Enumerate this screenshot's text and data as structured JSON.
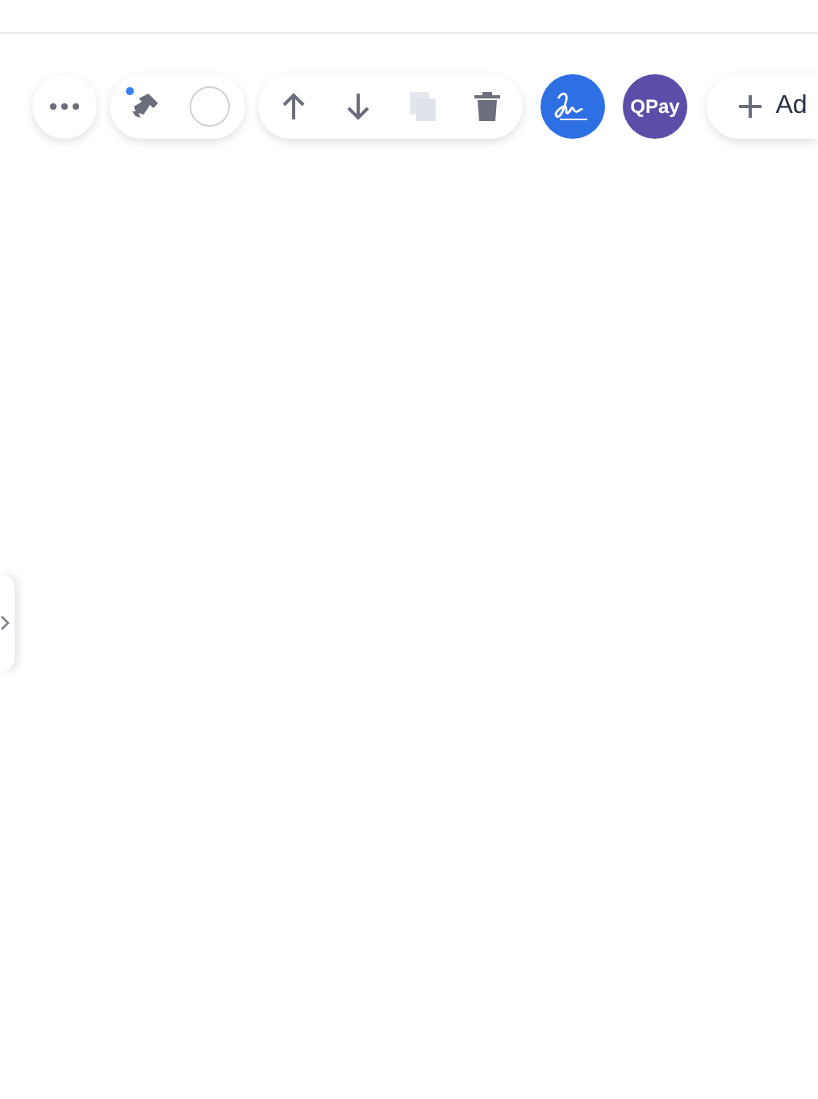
{
  "toolbar": {
    "groups": [
      {
        "kind": "single",
        "items": [
          {
            "kind": "more",
            "disabled": false,
            "indicator": false
          }
        ]
      },
      {
        "kind": "pill",
        "items": [
          {
            "kind": "brush",
            "disabled": false,
            "indicator": true
          },
          {
            "kind": "swatch",
            "disabled": false,
            "indicator": false
          }
        ]
      },
      {
        "kind": "pill",
        "items": [
          {
            "kind": "up",
            "disabled": false,
            "indicator": false
          },
          {
            "kind": "down",
            "disabled": false,
            "indicator": false
          },
          {
            "kind": "copy",
            "disabled": true,
            "indicator": false
          },
          {
            "kind": "trash",
            "disabled": false,
            "indicator": false
          }
        ]
      }
    ],
    "apps": [
      {
        "kind": "signature",
        "color": "#2f6fe4"
      },
      {
        "kind": "text",
        "label": "QPay",
        "color": "#5b4ea8"
      }
    ],
    "add_button": {
      "label": "Ad"
    }
  },
  "side_panel": {
    "expanded": false
  }
}
